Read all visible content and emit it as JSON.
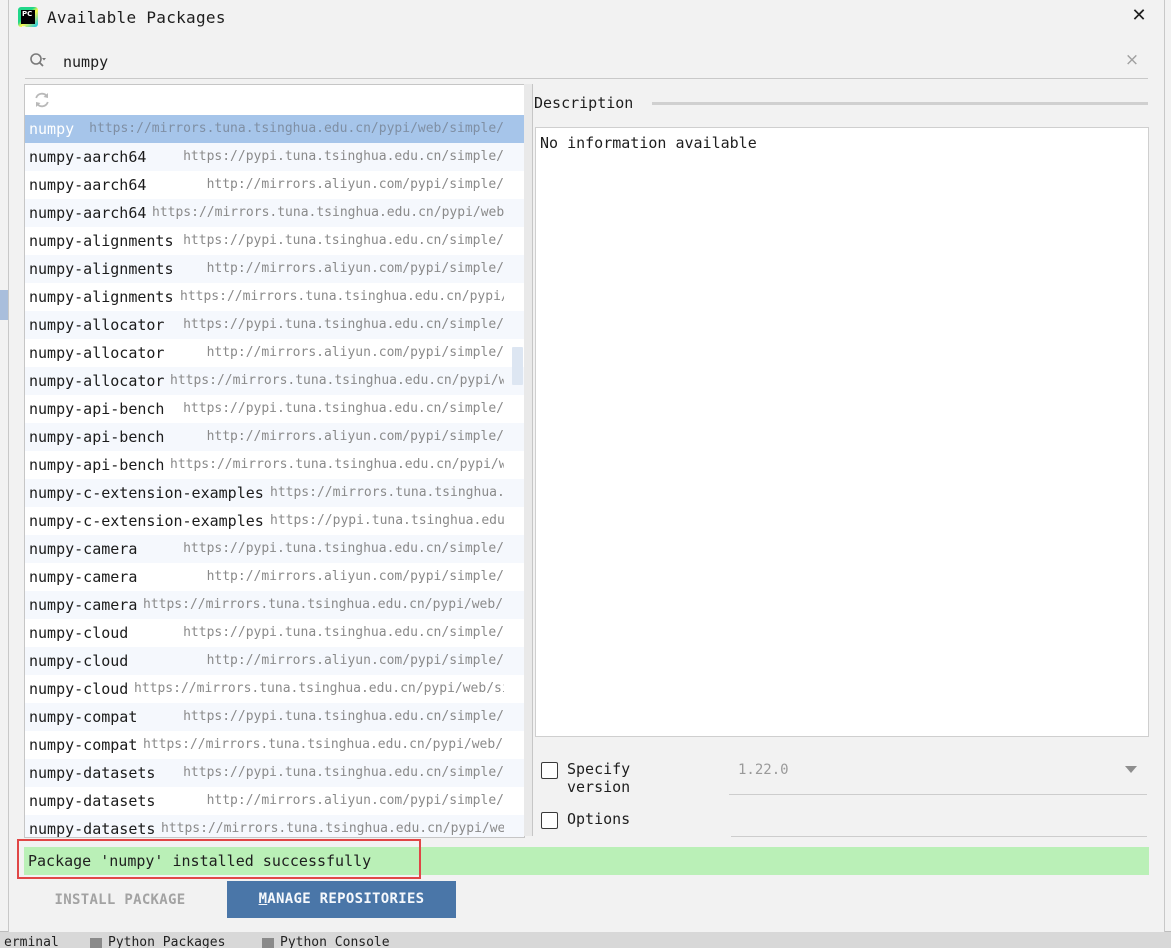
{
  "window": {
    "title": "Available Packages"
  },
  "search": {
    "value": "numpy"
  },
  "packages": [
    {
      "name": "numpy",
      "repo": "https://mirrors.tuna.tsinghua.edu.cn/pypi/web/simple/",
      "selected": true
    },
    {
      "name": "numpy-aarch64",
      "repo": "https://pypi.tuna.tsinghua.edu.cn/simple/"
    },
    {
      "name": "numpy-aarch64",
      "repo": "http://mirrors.aliyun.com/pypi/simple/"
    },
    {
      "name": "numpy-aarch64",
      "repo": "https://mirrors.tuna.tsinghua.edu.cn/pypi/web/simple/"
    },
    {
      "name": "numpy-alignments",
      "repo": "https://pypi.tuna.tsinghua.edu.cn/simple/"
    },
    {
      "name": "numpy-alignments",
      "repo": "http://mirrors.aliyun.com/pypi/simple/"
    },
    {
      "name": "numpy-alignments",
      "repo": "https://mirrors.tuna.tsinghua.edu.cn/pypi/web/simple/"
    },
    {
      "name": "numpy-allocator",
      "repo": "https://pypi.tuna.tsinghua.edu.cn/simple/"
    },
    {
      "name": "numpy-allocator",
      "repo": "http://mirrors.aliyun.com/pypi/simple/"
    },
    {
      "name": "numpy-allocator",
      "repo": "https://mirrors.tuna.tsinghua.edu.cn/pypi/web/simple/"
    },
    {
      "name": "numpy-api-bench",
      "repo": "https://pypi.tuna.tsinghua.edu.cn/simple/"
    },
    {
      "name": "numpy-api-bench",
      "repo": "http://mirrors.aliyun.com/pypi/simple/"
    },
    {
      "name": "numpy-api-bench",
      "repo": "https://mirrors.tuna.tsinghua.edu.cn/pypi/web/simple/"
    },
    {
      "name": "numpy-c-extension-examples",
      "repo": "https://mirrors.tuna.tsinghua.edu.cn/pypi/web/simple/"
    },
    {
      "name": "numpy-c-extension-examples",
      "repo": "https://pypi.tuna.tsinghua.edu.cn/simple/"
    },
    {
      "name": "numpy-camera",
      "repo": "https://pypi.tuna.tsinghua.edu.cn/simple/"
    },
    {
      "name": "numpy-camera",
      "repo": "http://mirrors.aliyun.com/pypi/simple/"
    },
    {
      "name": "numpy-camera",
      "repo": "https://mirrors.tuna.tsinghua.edu.cn/pypi/web/simple/"
    },
    {
      "name": "numpy-cloud",
      "repo": "https://pypi.tuna.tsinghua.edu.cn/simple/"
    },
    {
      "name": "numpy-cloud",
      "repo": "http://mirrors.aliyun.com/pypi/simple/"
    },
    {
      "name": "numpy-cloud",
      "repo": "https://mirrors.tuna.tsinghua.edu.cn/pypi/web/simple/"
    },
    {
      "name": "numpy-compat",
      "repo": "https://pypi.tuna.tsinghua.edu.cn/simple/"
    },
    {
      "name": "numpy-compat",
      "repo": "https://mirrors.tuna.tsinghua.edu.cn/pypi/web/simple/"
    },
    {
      "name": "numpy-datasets",
      "repo": "https://pypi.tuna.tsinghua.edu.cn/simple/"
    },
    {
      "name": "numpy-datasets",
      "repo": "http://mirrors.aliyun.com/pypi/simple/"
    },
    {
      "name": "numpy-datasets",
      "repo": "https://mirrors.tuna.tsinghua.edu.cn/pypi/web/simple/"
    }
  ],
  "description": {
    "header": "Description",
    "text": "No information available"
  },
  "options": {
    "specify_version_label": "Specify version",
    "version_value": "1.22.0",
    "options_label": "Options"
  },
  "status": {
    "message": "Package 'numpy' installed successfully"
  },
  "buttons": {
    "install": "INSTALL PACKAGE",
    "manage_first": "M",
    "manage_rest": "ANAGE REPOSITORIES"
  },
  "background_tabs": {
    "terminal": "erminal",
    "python_packages": "Python Packages",
    "python_console": "Python Console"
  },
  "colors": {
    "selection": "#a6c5ea",
    "status_bg": "#baf0b7",
    "highlight_outline": "#e04646",
    "primary_button": "#4a76a8"
  }
}
